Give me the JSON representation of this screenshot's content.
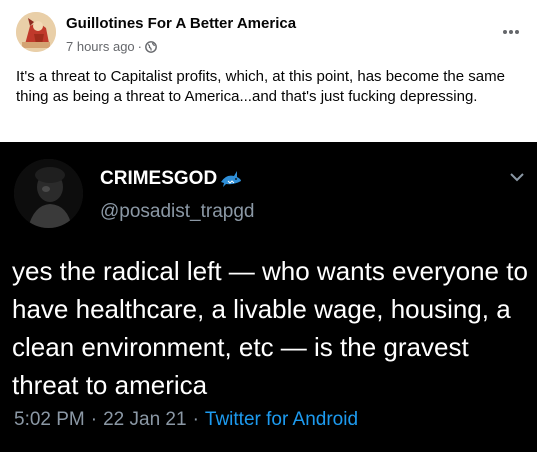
{
  "post": {
    "page_name": "Guillotines For A Better America",
    "time": "7 hours ago",
    "separator": "·",
    "audience_icon": "globe-icon",
    "more_icon": "more-options-icon",
    "text": "It's a threat to Capitalist profits, which, at this point, has become the same thing as being a threat to America...and that's just fucking depressing."
  },
  "tweet": {
    "display_name": "CRIMESGOD",
    "name_emoji": "shark-emoji-icon",
    "handle": "@posadist_trapgd",
    "text": "yes the radical left — who wants everyone to have healthcare, a livable wage, housing, a clean environment, etc — is the gravest threat to america",
    "time": "5:02 PM",
    "sep1": "·",
    "date": "22 Jan 21",
    "sep2": "·",
    "source": "Twitter for Android",
    "chevron_icon": "chevron-down-icon"
  },
  "colors": {
    "text_primary": "#050505",
    "text_secondary": "#65676b",
    "tweet_bg": "#000000",
    "tweet_muted": "#8b98a5",
    "tweet_link": "#1d9bf0"
  }
}
